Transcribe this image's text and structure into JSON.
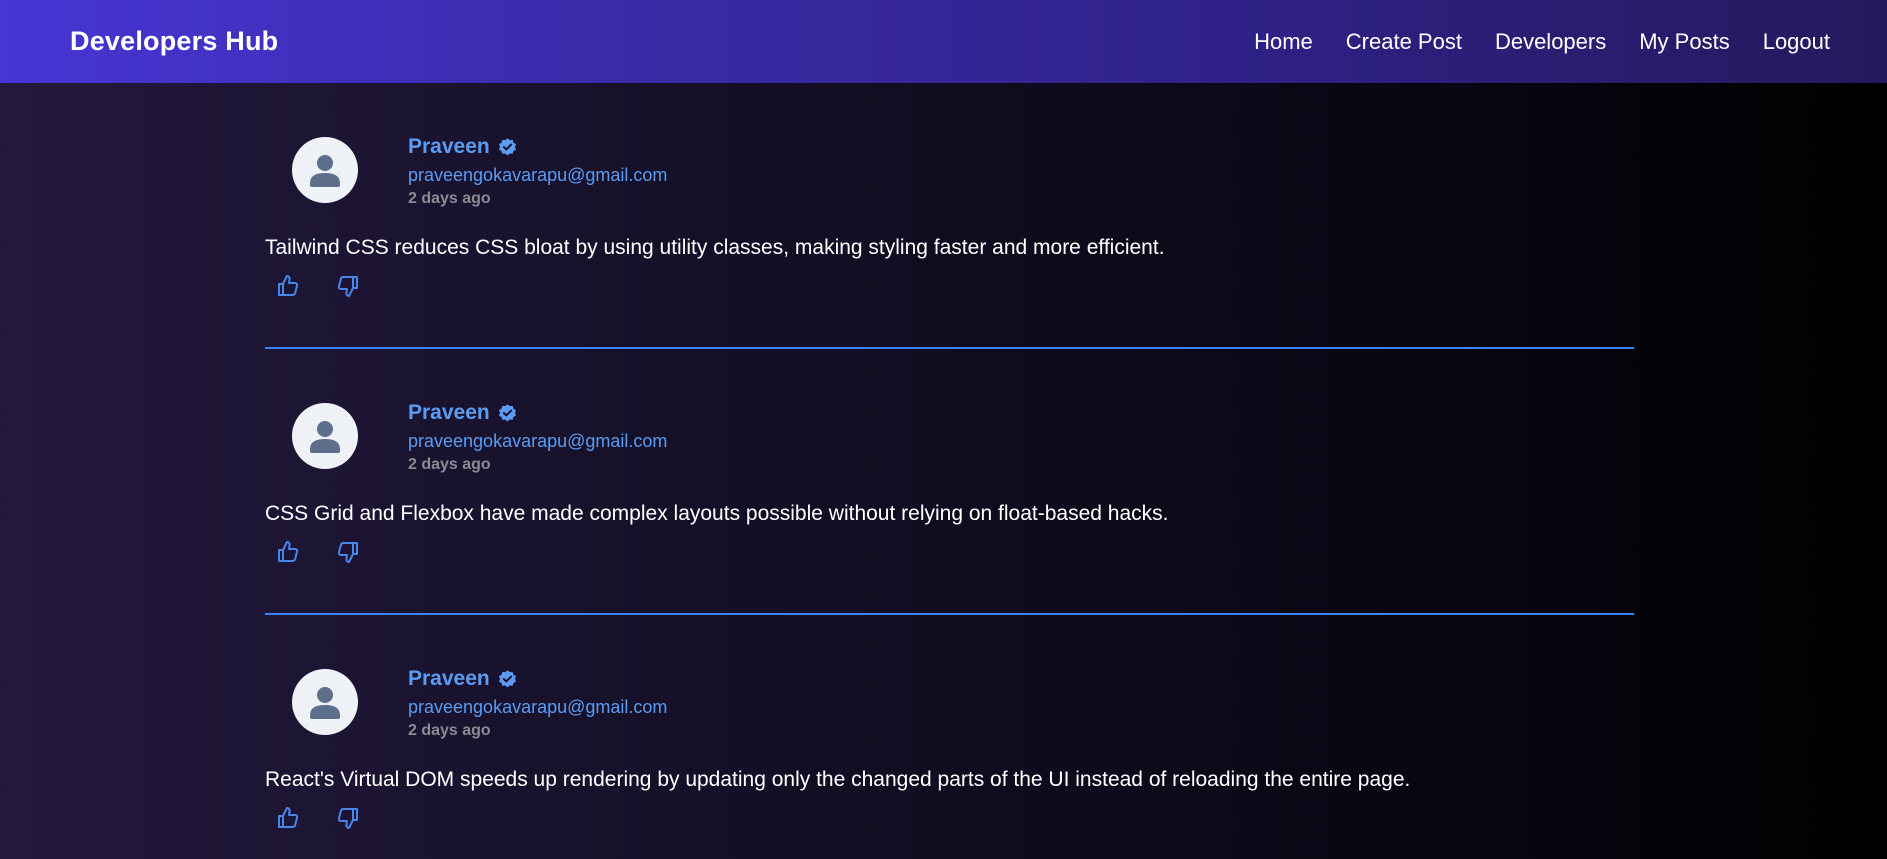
{
  "nav": {
    "brand": "Developers Hub",
    "links": [
      "Home",
      "Create Post",
      "Developers",
      "My Posts",
      "Logout"
    ]
  },
  "colors": {
    "accent": "#5b9cf3",
    "divider": "#3b82f6",
    "muted": "#8b8b94"
  },
  "posts": [
    {
      "author": "Praveen",
      "email": "praveengokavarapu@gmail.com",
      "time": "2 days ago",
      "content": "Tailwind CSS reduces CSS bloat by using utility classes, making styling faster and more efficient."
    },
    {
      "author": "Praveen",
      "email": "praveengokavarapu@gmail.com",
      "time": "2 days ago",
      "content": "CSS Grid and Flexbox have made complex layouts possible without relying on float-based hacks."
    },
    {
      "author": "Praveen",
      "email": "praveengokavarapu@gmail.com",
      "time": "2 days ago",
      "content": "React's Virtual DOM speeds up rendering by updating only the changed parts of the UI instead of reloading the entire page."
    }
  ]
}
